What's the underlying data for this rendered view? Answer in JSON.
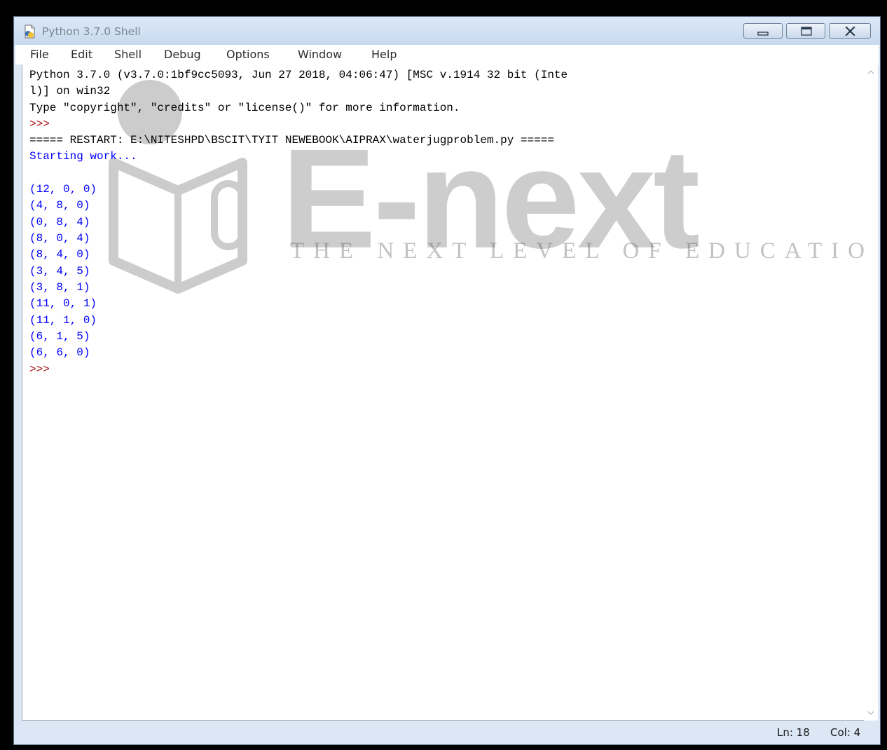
{
  "window": {
    "title": "Python 3.7.0 Shell"
  },
  "menu": [
    "File",
    "Edit",
    "Shell",
    "Debug",
    "Options",
    "Window",
    "Help"
  ],
  "console": {
    "header_line1": "Python 3.7.0 (v3.7.0:1bf9cc5093, Jun 27 2018, 04:06:47) [MSC v.1914 32 bit (Inte",
    "header_line2": "l)] on win32",
    "header_line3": "Type \"copyright\", \"credits\" or \"license()\" for more information.",
    "prompt": ">>>",
    "restart_line": "===== RESTART: E:\\NITESHPD\\BSCIT\\TYIT NEWEBOOK\\AIPRAX\\waterjugproblem.py =====",
    "starting": "Starting work...",
    "outputs": [
      "(12, 0, 0)",
      "(4, 8, 0)",
      "(0, 8, 4)",
      "(8, 0, 4)",
      "(8, 4, 0)",
      "(3, 4, 5)",
      "(3, 8, 1)",
      "(11, 0, 1)",
      "(11, 1, 0)",
      "(6, 1, 5)",
      "(6, 6, 0)"
    ],
    "final_prompt": ">>>"
  },
  "watermark": {
    "brand": "E-next",
    "tagline": "THE NEXT LEVEL OF EDUCATION"
  },
  "status": {
    "line": "Ln: 18",
    "col": "Col: 4"
  },
  "colors": {
    "stdout": "#0000ff",
    "prompt": "#aa1111",
    "frame": "#dbe7f5"
  },
  "icons": {
    "app": "python-idle-icon",
    "minimize": "minimize-icon",
    "maximize": "maximize-icon",
    "close": "close-icon"
  }
}
